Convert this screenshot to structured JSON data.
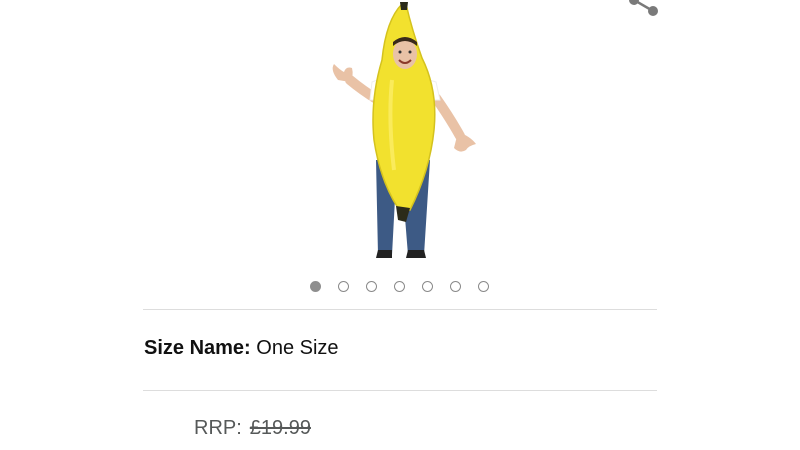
{
  "product": {
    "image_alt": "Adult banana costume",
    "gallery": {
      "total": 7,
      "active_index": 0
    }
  },
  "toolbar": {
    "share_icon": "share-icon"
  },
  "variation": {
    "label": "Size Name:",
    "value": "One Size"
  },
  "pricing": {
    "rrp_label": "RRP:",
    "rrp_value": "£19.99"
  },
  "colors": {
    "costume_yellow": "#f2e12e",
    "dot_active": "#8f8f8f",
    "divider": "#dddddd",
    "muted_text": "#565959"
  }
}
